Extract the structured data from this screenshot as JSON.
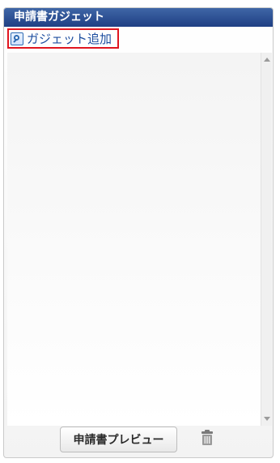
{
  "panel": {
    "title": "申請書ガジェット"
  },
  "add_gadget": {
    "label": "ガジェット追加"
  },
  "footer": {
    "preview_label": "申請書プレビュー"
  },
  "icons": {
    "add_gadget": "add-gadget-search-icon",
    "delete": "trash-icon",
    "scroll_up": "scroll-up-arrow-icon",
    "scroll_down": "scroll-down-arrow-icon"
  },
  "colors": {
    "header_bg": "#1f3f84",
    "link_text": "#1f4fa0",
    "highlight_border": "#e0151f"
  }
}
